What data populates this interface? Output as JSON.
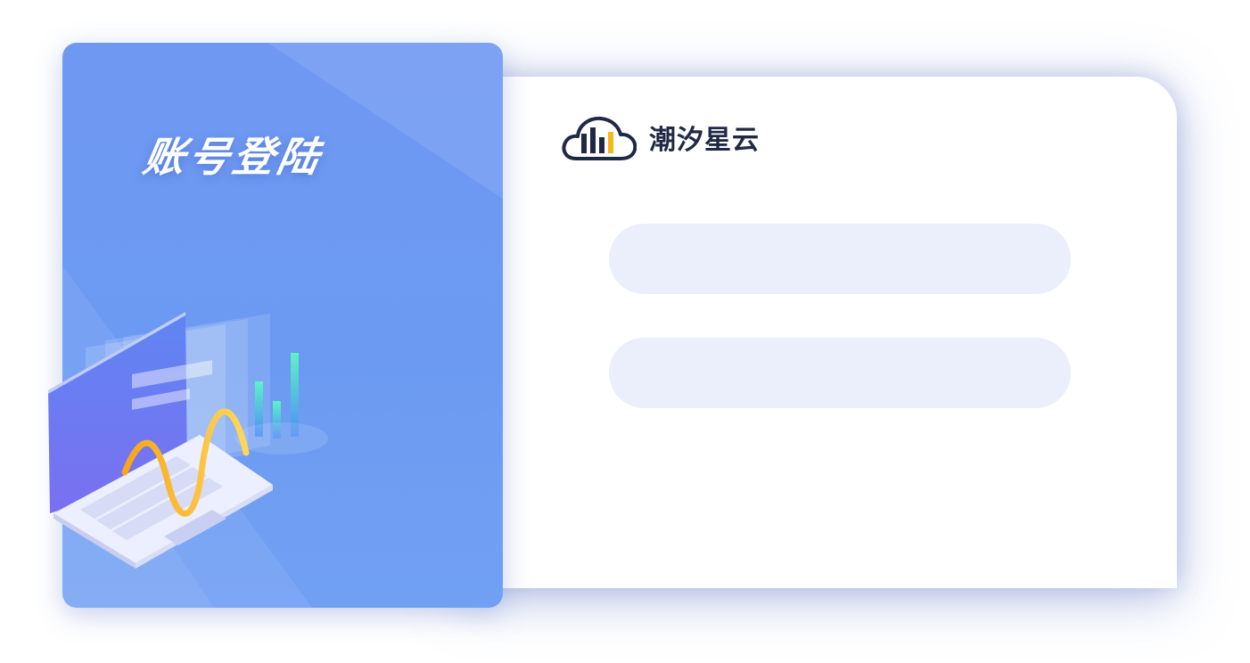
{
  "panel": {
    "title": "账号登陆"
  },
  "brand": {
    "name": "潮汐星云",
    "logo_icon": "cloud-bar-chart-icon",
    "colors": {
      "dark": "#1f2845",
      "accent": "#f5b71c"
    }
  },
  "form": {
    "username": {
      "value": "",
      "placeholder": ""
    },
    "password": {
      "value": "",
      "placeholder": ""
    }
  },
  "colors": {
    "panel_blue": "#6f98f2",
    "field_bg": "#ebeefb",
    "wave_gold": "#f2b21a"
  }
}
